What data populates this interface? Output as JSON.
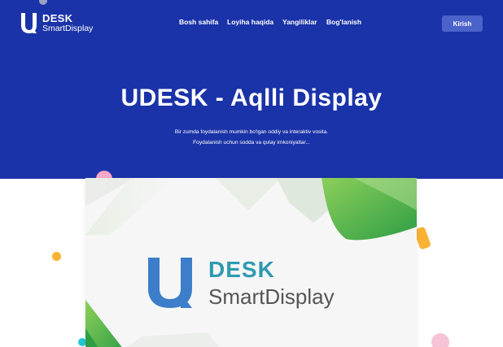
{
  "brand": {
    "name": "DESK",
    "subtitle": "SmartDisplay",
    "icon": "u-logo-icon"
  },
  "nav": {
    "items": [
      {
        "label": "Bosh sahifa"
      },
      {
        "label": "Loyiha haqida"
      },
      {
        "label": "Yangiliklar"
      },
      {
        "label": "Bog'lanish"
      }
    ],
    "login_label": "Kirish"
  },
  "hero": {
    "title": "UDESK - Aqlli Display",
    "description_line1": "Bir zumda foydalanish mumkin bo'lgan oddiy va interaktiv vosita.",
    "description_line2": "Foydalanish uchun sodda va qulay imkoniyatlar..."
  },
  "preview": {
    "brand_name": "DESK",
    "brand_subtitle": "SmartDisplay"
  },
  "colors": {
    "hero_bg": "#1b33a8",
    "login_bg": "#4a62c9",
    "accent_green": "#3aa74a",
    "accent_teal": "#2e9ab0",
    "logo_blue": "#3c7ec9"
  }
}
